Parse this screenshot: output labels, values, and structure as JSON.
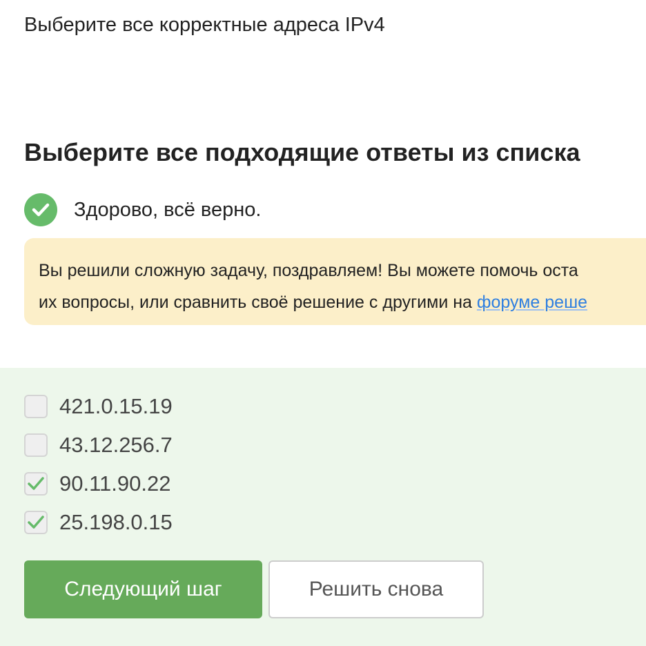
{
  "question": {
    "text": "Выберите все корректные адреса IPv4"
  },
  "instruction": {
    "text": "Выберите все подходящие ответы из списка"
  },
  "status": {
    "text": "Здорово, всё верно.",
    "icon": "check-circle-icon",
    "color": "#66bb6a"
  },
  "hint": {
    "line1": "Вы решили сложную задачу, поздравляем! Вы можете помочь оста",
    "line2_prefix": "их вопросы, или сравнить своё решение с другими на ",
    "link_text": "форуме реше"
  },
  "options": [
    {
      "label": "421.0.15.19",
      "checked": false
    },
    {
      "label": "43.12.256.7",
      "checked": false
    },
    {
      "label": "90.11.90.22",
      "checked": true
    },
    {
      "label": "25.198.0.15",
      "checked": true
    }
  ],
  "buttons": {
    "next_label": "Следующий шаг",
    "retry_label": "Решить снова"
  },
  "colors": {
    "accent_green": "#66aa5a",
    "panel_bg": "#edf7eb",
    "hint_bg": "#fcefc9",
    "link": "#2f7fe0"
  }
}
